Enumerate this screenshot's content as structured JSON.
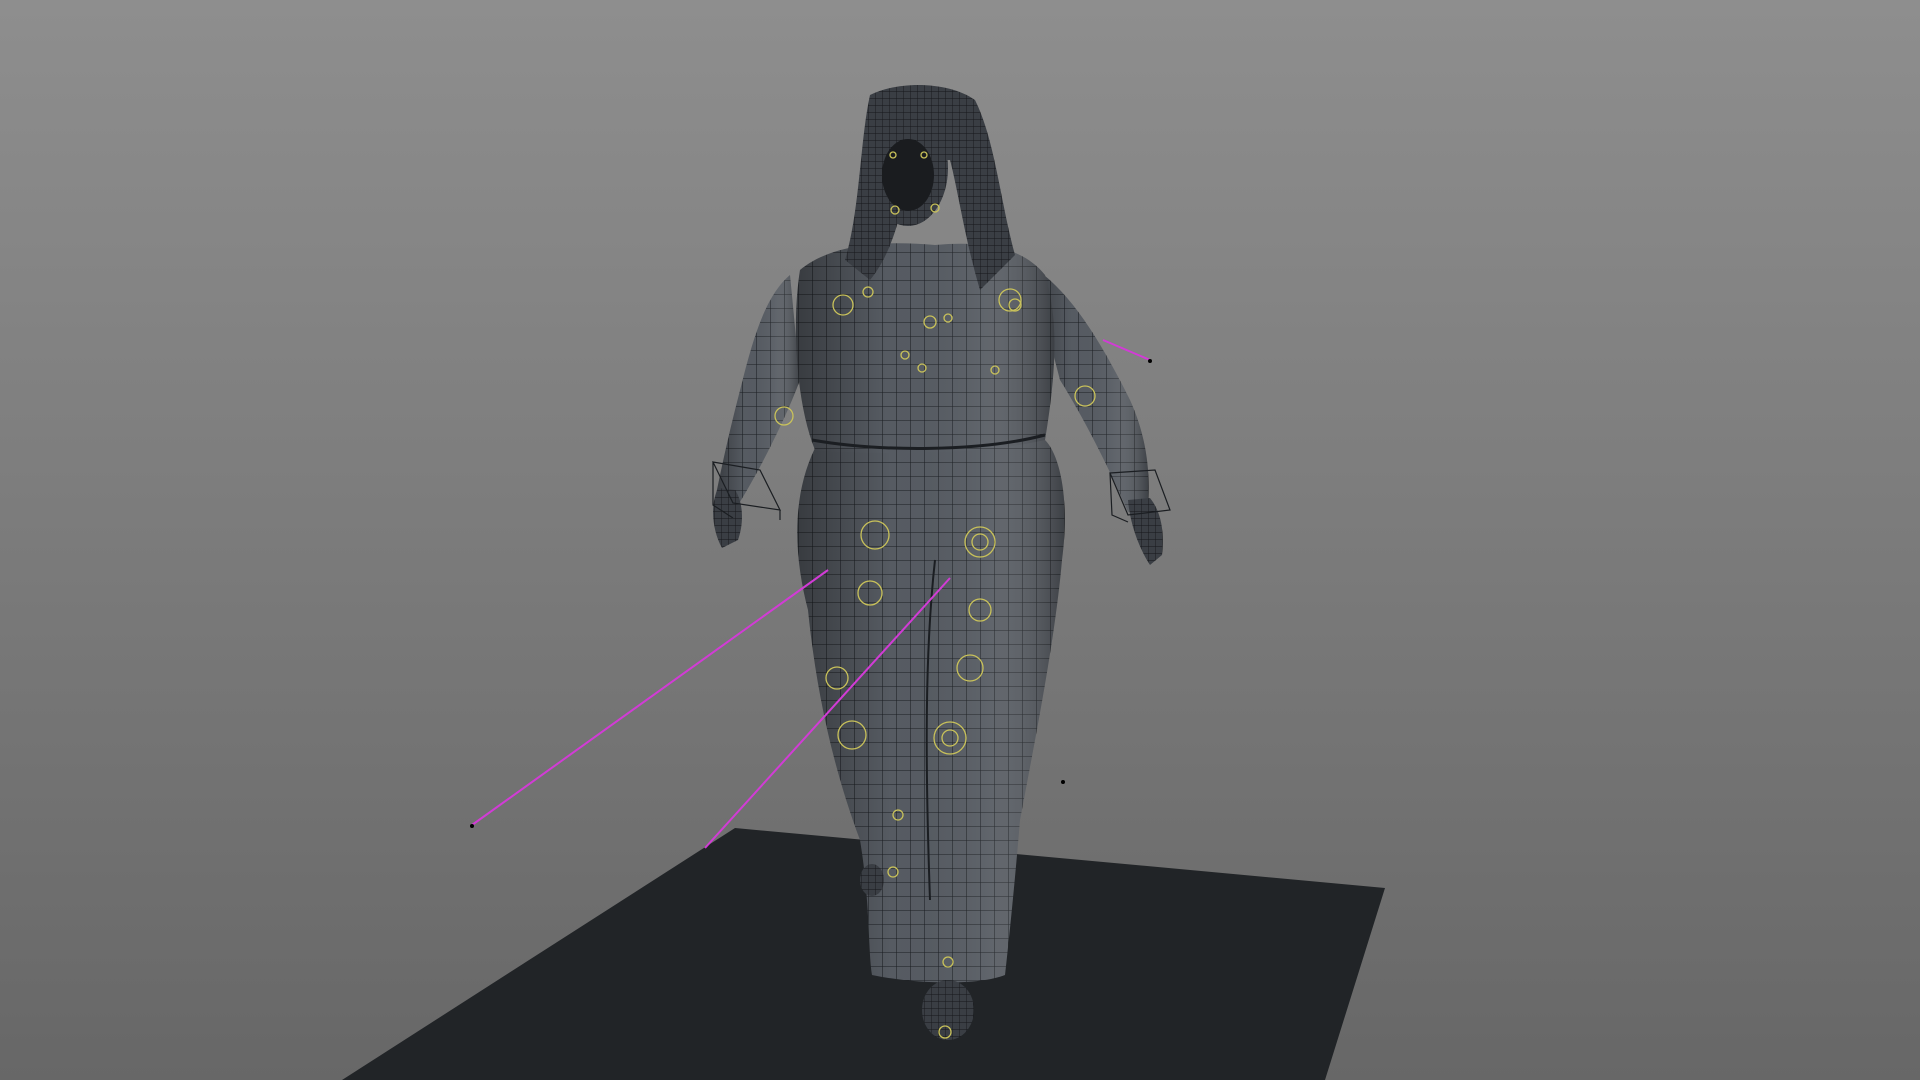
{
  "viewport": {
    "background_top": "#8e8e8e",
    "background_bottom": "#676767",
    "ground_color": "#212427",
    "mesh_fill": "#53585f",
    "mesh_wire": "#1a1d21",
    "rig_control_color": "#c9c25a",
    "ik_line_color": "#d23bd6",
    "locator_color": "#000000"
  },
  "scene": {
    "object": "wireframe-character-mesh",
    "controls": [
      "ik-handle-left-leg",
      "ik-handle-right-leg",
      "ik-handle-left-arm",
      "hand-control-left",
      "hand-control-right"
    ]
  }
}
